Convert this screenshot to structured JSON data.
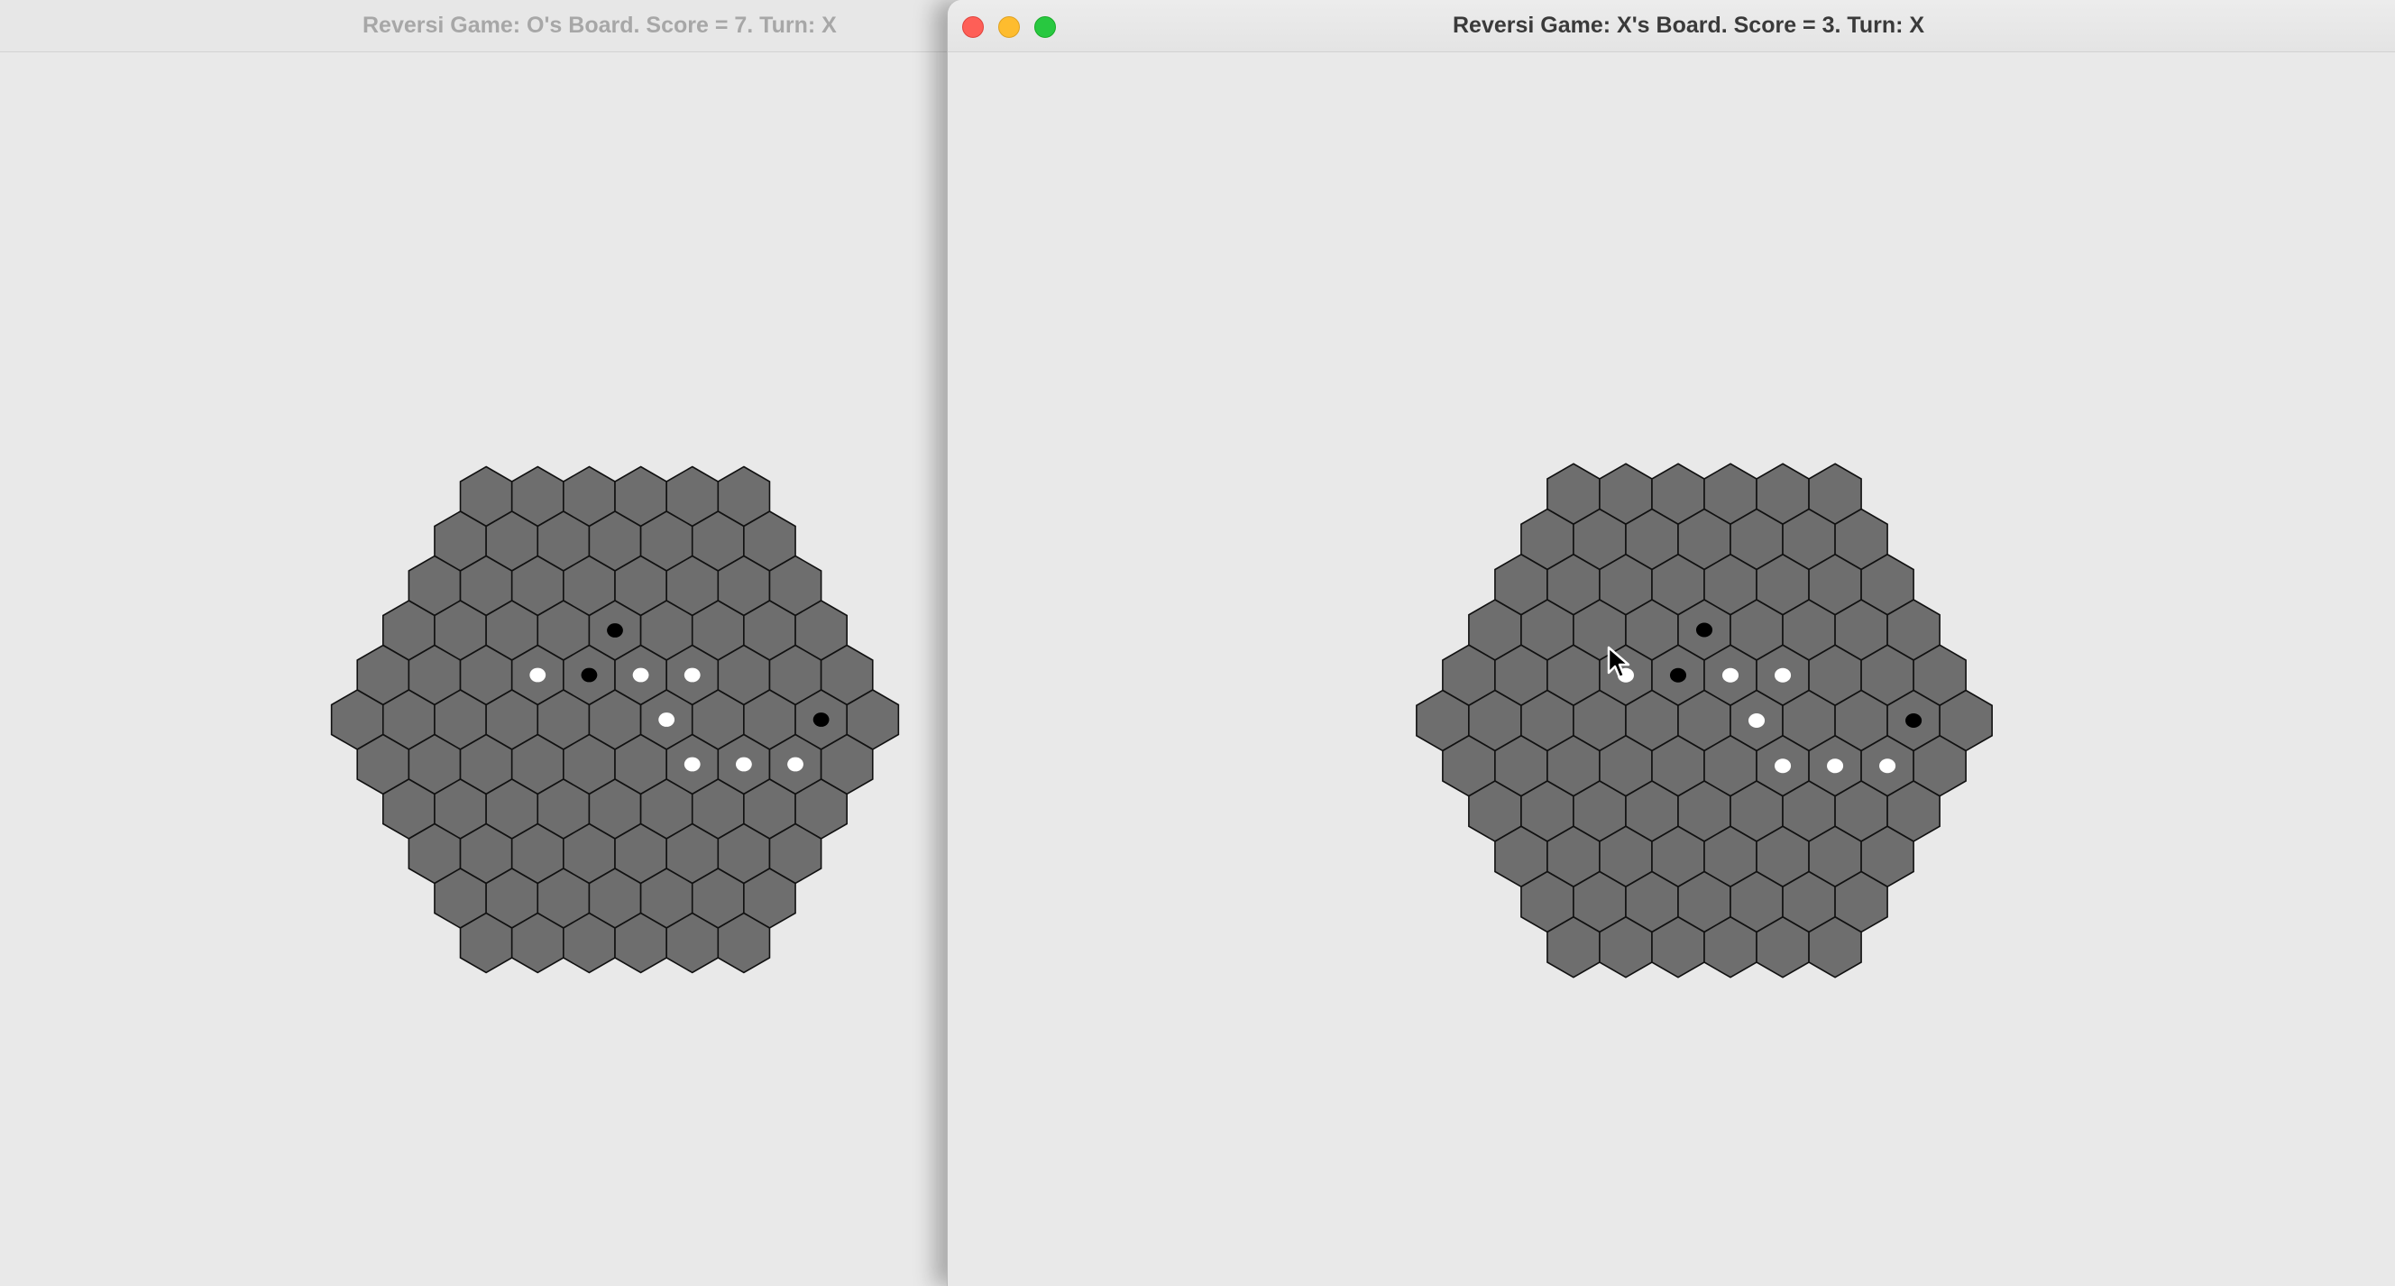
{
  "left_window": {
    "title": "Reversi Game: O's Board. Score = 7. Turn: X",
    "active": false
  },
  "right_window": {
    "title": "Reversi Game: X's Board. Score = 3. Turn: X",
    "active": true,
    "controls": {
      "close": "close-button",
      "minimize": "minimize-button",
      "maximize": "zoom-button"
    }
  },
  "board": {
    "radius": 5,
    "cell_color": "#6e6e6e",
    "cell_border_color": "#111111",
    "white_piece_color": "#ffffff",
    "black_piece_color": "#000000",
    "black_pieces": [
      {
        "row": 3,
        "col": 4
      },
      {
        "row": 4,
        "col": 4
      },
      {
        "row": 5,
        "col": 9
      }
    ],
    "white_pieces": [
      {
        "row": 4,
        "col": 3
      },
      {
        "row": 4,
        "col": 5
      },
      {
        "row": 4,
        "col": 6
      },
      {
        "row": 5,
        "col": 6
      },
      {
        "row": 6,
        "col": 6
      },
      {
        "row": 6,
        "col": 7
      },
      {
        "row": 6,
        "col": 8
      }
    ]
  }
}
